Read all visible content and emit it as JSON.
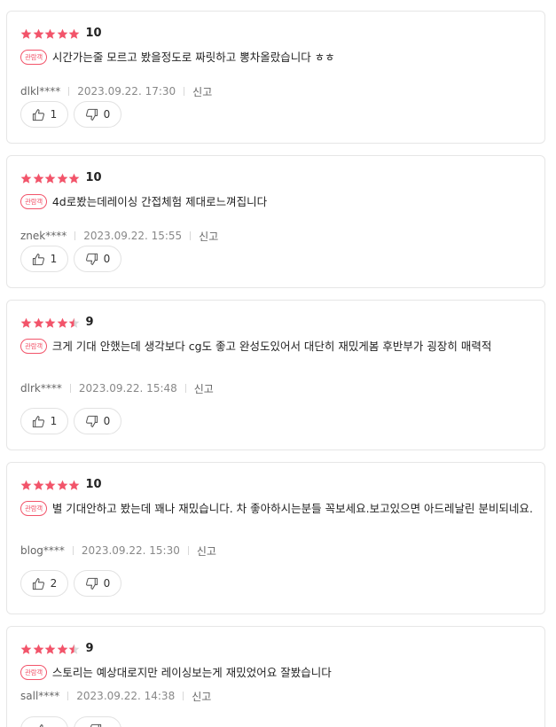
{
  "reviews": [
    {
      "stars": 5,
      "score": "10",
      "badge": "관람객",
      "comment": "시간가는줄 모르고 봤을정도로 짜릿하고 뽕차올랐습니다 ㅎㅎ",
      "user": "dlkl****",
      "date": "2023.09.22. 17:30",
      "report": "신고",
      "likes": "1",
      "dislikes": "0"
    },
    {
      "stars": 5,
      "score": "10",
      "badge": "관람객",
      "comment": "4d로봤는데레이싱 간접체험 제대로느껴집니다",
      "user": "znek****",
      "date": "2023.09.22. 15:55",
      "report": "신고",
      "likes": "1",
      "dislikes": "0"
    },
    {
      "stars": 4.5,
      "score": "9",
      "badge": "관람객",
      "comment": "크게 기대 안했는데 생각보다 cg도 좋고 완성도있어서 대단히 재밌게봄 후반부가 굉장히 매력적",
      "user": "dlrk****",
      "date": "2023.09.22. 15:48",
      "report": "신고",
      "likes": "1",
      "dislikes": "0"
    },
    {
      "stars": 5,
      "score": "10",
      "badge": "관람객",
      "comment": "별 기대안하고 봤는데 꽤나 재밌습니다. 차 좋아하시는분들 꼭보세요.보고있으면 아드레날린 분비되네요.",
      "user": "blog****",
      "date": "2023.09.22. 15:30",
      "report": "신고",
      "likes": "2",
      "dislikes": "0"
    },
    {
      "stars": 4.5,
      "score": "9",
      "badge": "관람객",
      "comment": "스토리는 예상대로지만 레이싱보는게 재밌었어요 잘봤습니다",
      "user": "sall****",
      "date": "2023.09.22. 14:38",
      "report": "신고",
      "likes": "",
      "dislikes": ""
    }
  ],
  "icons": {
    "star": "star-icon",
    "like": "thumbs-up-icon",
    "dislike": "thumbs-down-icon"
  },
  "colors": {
    "star": "#f2546a",
    "badge": "#f2546a",
    "star_empty": "#d9d9d9"
  }
}
